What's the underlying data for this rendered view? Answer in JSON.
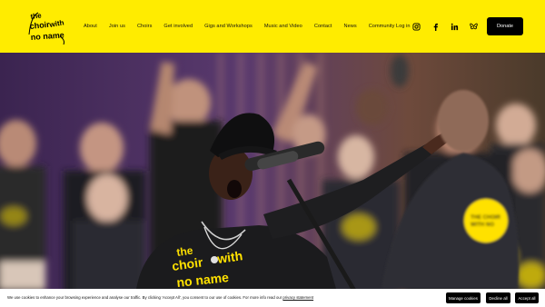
{
  "brand": {
    "logo_text": "the choir with no name"
  },
  "nav": {
    "items": [
      {
        "label": "About"
      },
      {
        "label": "Join us"
      },
      {
        "label": "Choirs"
      },
      {
        "label": "Get involved"
      },
      {
        "label": "Gigs and Workshops"
      },
      {
        "label": "Music and Video"
      },
      {
        "label": "Contact"
      },
      {
        "label": "News"
      },
      {
        "label": "Community Log in"
      }
    ]
  },
  "social": {
    "icons": [
      "instagram-icon",
      "facebook-icon",
      "linkedin-icon",
      "bluesky-icon"
    ]
  },
  "donate": {
    "label": "Donate"
  },
  "hero": {
    "shirt_text": "the choir with no name",
    "shirt_badge_text": "THE CHOIR WITH NO NAME"
  },
  "cookie": {
    "text": "We use cookies to enhance your browsing experience and analyse our traffic. By clicking 'Accept All', you consent to our use of cookies. For more info read our",
    "link": "privacy statement",
    "manage_label": "Manage cookies",
    "decline_label": "Decline all",
    "accept_label": "Accept all"
  },
  "colors": {
    "brand_yellow": "#ffec00",
    "black": "#000000",
    "purple_bg": "#4a2a66"
  }
}
